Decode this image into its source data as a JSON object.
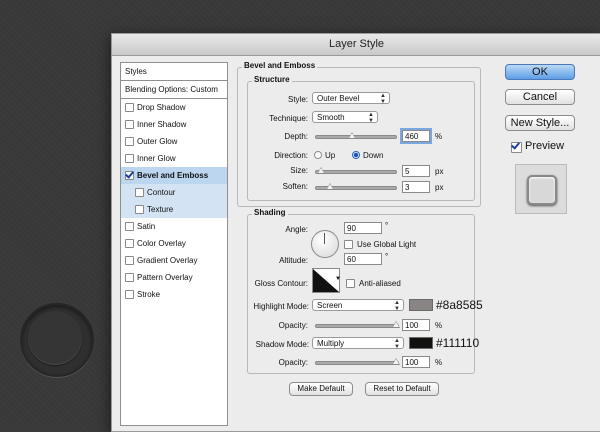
{
  "dialog": {
    "title": "Layer Style"
  },
  "sidebar": {
    "header": "Styles",
    "blending": "Blending Options: Custom",
    "items": [
      {
        "label": "Drop Shadow",
        "checked": false
      },
      {
        "label": "Inner Shadow",
        "checked": false
      },
      {
        "label": "Outer Glow",
        "checked": false
      },
      {
        "label": "Inner Glow",
        "checked": false
      },
      {
        "label": "Bevel and Emboss",
        "checked": true,
        "selected": true
      },
      {
        "label": "Contour",
        "checked": false,
        "sub": true
      },
      {
        "label": "Texture",
        "checked": false,
        "sub": true
      },
      {
        "label": "Satin",
        "checked": false
      },
      {
        "label": "Color Overlay",
        "checked": false
      },
      {
        "label": "Gradient Overlay",
        "checked": false
      },
      {
        "label": "Pattern Overlay",
        "checked": false
      },
      {
        "label": "Stroke",
        "checked": false
      }
    ]
  },
  "bevel": {
    "section_title": "Bevel and Emboss",
    "structure_title": "Structure",
    "style_label": "Style:",
    "style_value": "Outer Bevel",
    "technique_label": "Technique:",
    "technique_value": "Smooth",
    "depth_label": "Depth:",
    "depth_value": "460",
    "depth_unit": "%",
    "direction_label": "Direction:",
    "direction_up": "Up",
    "direction_down": "Down",
    "size_label": "Size:",
    "size_value": "5",
    "size_unit": "px",
    "soften_label": "Soften:",
    "soften_value": "3",
    "soften_unit": "px"
  },
  "shading": {
    "title": "Shading",
    "angle_label": "Angle:",
    "angle_value": "90",
    "angle_unit": "°",
    "global_light_label": "Use Global Light",
    "altitude_label": "Altitude:",
    "altitude_value": "60",
    "altitude_unit": "°",
    "gloss_label": "Gloss Contour:",
    "antialiased_label": "Anti-aliased",
    "highlight_mode_label": "Highlight Mode:",
    "highlight_mode_value": "Screen",
    "highlight_color": "#8a8585",
    "highlight_hex": "#8a8585",
    "highlight_opacity_label": "Opacity:",
    "highlight_opacity_value": "100",
    "opacity_unit": "%",
    "shadow_mode_label": "Shadow Mode:",
    "shadow_mode_value": "Multiply",
    "shadow_color": "#111110",
    "shadow_hex": "#111110",
    "shadow_opacity_label": "Opacity:",
    "shadow_opacity_value": "100"
  },
  "buttons": {
    "ok": "OK",
    "cancel": "Cancel",
    "new_style": "New Style...",
    "preview_label": "Preview",
    "make_default": "Make Default",
    "reset_default": "Reset to Default"
  }
}
